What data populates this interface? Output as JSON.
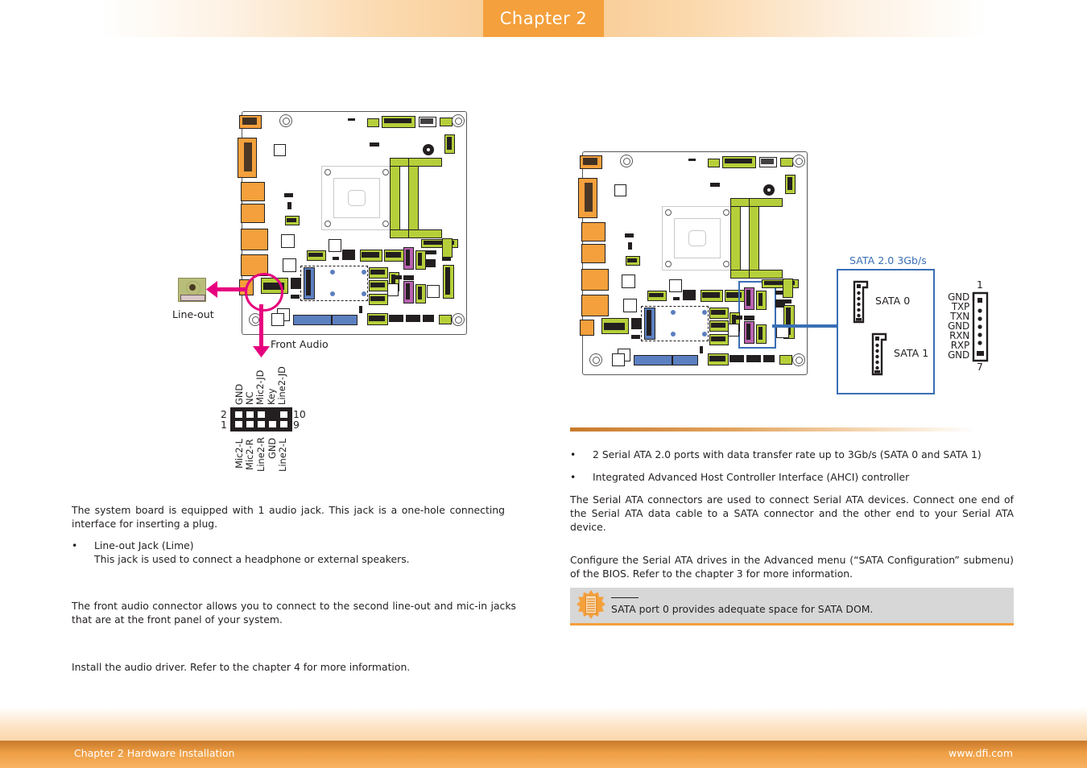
{
  "header": {
    "chapter_tab": "Chapter 2"
  },
  "footer": {
    "left": "Chapter 2 Hardware Installation",
    "right": "www.dfi.com"
  },
  "left_column": {
    "jack_label": "Line-out",
    "connector_label": "Front Audio",
    "front_audio_pins": {
      "top_labels": [
        "GND",
        "NC",
        "Mic2-JD",
        "Key",
        "Line2-JD"
      ],
      "bottom_labels": [
        "Mic2-L",
        "Mic2-R",
        "Line2-R",
        "GND",
        "Line2-L"
      ],
      "corner_numbers": {
        "top_left": "2",
        "bottom_left": "1",
        "top_right": "10",
        "bottom_right": "9"
      }
    },
    "paragraphs": [
      "The system board is equipped with 1 audio jack. This jack is a one-hole connecting interface for inserting a plug.",
      "The front audio connector allows you to connect to the second line-out and mic-in jacks that are at the front panel of your system.",
      "Install the audio driver. Refer to the chapter 4 for more information."
    ],
    "bullets": [
      {
        "line1": "Line-out Jack (Lime)",
        "line2": "This jack is used to connect a headphone or external speakers."
      }
    ]
  },
  "right_column": {
    "sata_panel_title": "SATA 2.0 3Gb/s",
    "sata_connectors": [
      "SATA 0",
      "SATA 1"
    ],
    "sata_pin_labels": [
      "GND",
      "TXP",
      "TXN",
      "GND",
      "RXN",
      "RXP",
      "GND"
    ],
    "sata_pin_numbers": {
      "first": "1",
      "last": "7"
    },
    "bullets": [
      "2 Serial ATA 2.0 ports with data transfer rate up to 3Gb/s (SATA 0 and SATA 1)",
      "Integrated Advanced Host Controller Interface (AHCI) controller"
    ],
    "paragraphs": [
      "The Serial ATA connectors are used to connect Serial ATA devices. Connect one end of the Serial ATA data cable to a SATA connector and the other end to your Serial ATA device.",
      "Configure the Serial ATA drives in the Advanced menu (“SATA Configuration” submenu) of the BIOS. Refer to the chapter 3 for more information."
    ],
    "note": {
      "text": "SATA port 0 provides adequate space for SATA DOM."
    }
  },
  "colors": {
    "accent_orange": "#f4a03c",
    "magenta_callout": "#e6007e",
    "blue_callout": "#3a6fb5",
    "pcb_green": "#b5cf3a",
    "purple_connector": "#b863b0",
    "note_background": "#d7d7d7"
  },
  "bullet_glyph": "•"
}
